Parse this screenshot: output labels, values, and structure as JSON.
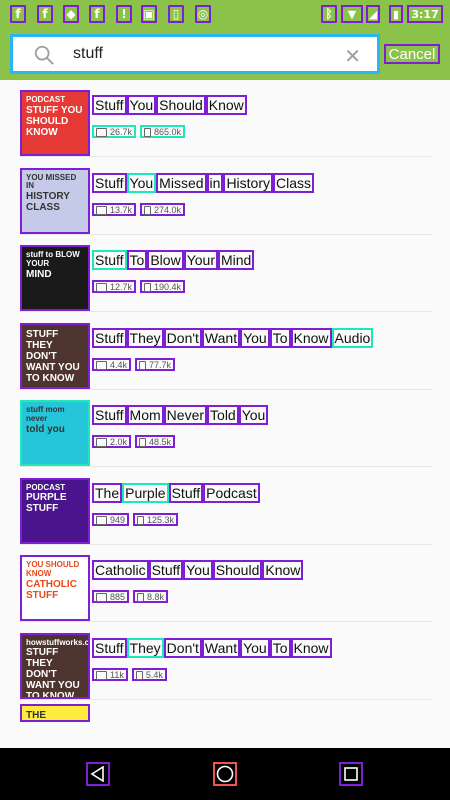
{
  "status_bar": {
    "time": "3:17",
    "colors": {
      "background": "#8bc34a"
    }
  },
  "search": {
    "query": "stuff",
    "cancel_label": "Cancel"
  },
  "results": [
    {
      "title_words": [
        "Stuff",
        "You",
        "Should",
        "Know"
      ],
      "followers": "26.7k",
      "listens": "865.0k",
      "thumb_text": "STUFF YOU SHOULD KNOW",
      "thumb_sub": "PODCAST",
      "thumb_bg": "#e53935"
    },
    {
      "title_words": [
        "Stuff",
        "You",
        "Missed",
        "in",
        "History",
        "Class"
      ],
      "followers": "13.7k",
      "listens": "274.0k",
      "thumb_text": "HISTORY CLASS",
      "thumb_sub": "YOU MISSED IN",
      "thumb_bg": "#c5cae9"
    },
    {
      "title_words": [
        "Stuff",
        "To",
        "Blow",
        "Your",
        "Mind"
      ],
      "followers": "12.7k",
      "listens": "190.4k",
      "thumb_text": "MIND",
      "thumb_sub": "stuff to BLOW YOUR",
      "thumb_bg": "#1a1a1a"
    },
    {
      "title_words": [
        "Stuff",
        "They",
        "Don't",
        "Want",
        "You",
        "To",
        "Know",
        "Audio"
      ],
      "followers": "4.4k",
      "listens": "77.7k",
      "thumb_text": "STUFF THEY DON'T WANT YOU TO KNOW",
      "thumb_sub": "",
      "thumb_bg": "#4e342e"
    },
    {
      "title_words": [
        "Stuff",
        "Mom",
        "Never",
        "Told",
        "You"
      ],
      "followers": "2.0k",
      "listens": "48.5k",
      "thumb_text": "told you",
      "thumb_sub": "stuff mom never",
      "thumb_bg": "#26c6da"
    },
    {
      "title_words": [
        "The",
        "Purple",
        "Stuff",
        "Podcast"
      ],
      "followers": "949",
      "listens": "125.3k",
      "thumb_text": "PURPLE STUFF",
      "thumb_sub": "PODCAST",
      "thumb_bg": "#4a148c"
    },
    {
      "title_words": [
        "Catholic",
        "Stuff",
        "You",
        "Should",
        "Know"
      ],
      "followers": "885",
      "listens": "8.8k",
      "thumb_text": "CATHOLIC STUFF",
      "thumb_sub": "YOU SHOULD KNOW",
      "thumb_bg": "#ffffff"
    },
    {
      "title_words": [
        "Stuff",
        "They",
        "Don't",
        "Want",
        "You",
        "To",
        "Know"
      ],
      "followers": "11k",
      "listens": "5.4k",
      "thumb_text": "STUFF THEY DON'T WANT YOU TO KNOW",
      "thumb_sub": "howstuffworks.com",
      "thumb_bg": "#4e342e"
    },
    {
      "title_words": [],
      "followers": "",
      "listens": "",
      "thumb_text": "THE",
      "thumb_sub": "",
      "thumb_bg": "#ffeb3b"
    }
  ]
}
